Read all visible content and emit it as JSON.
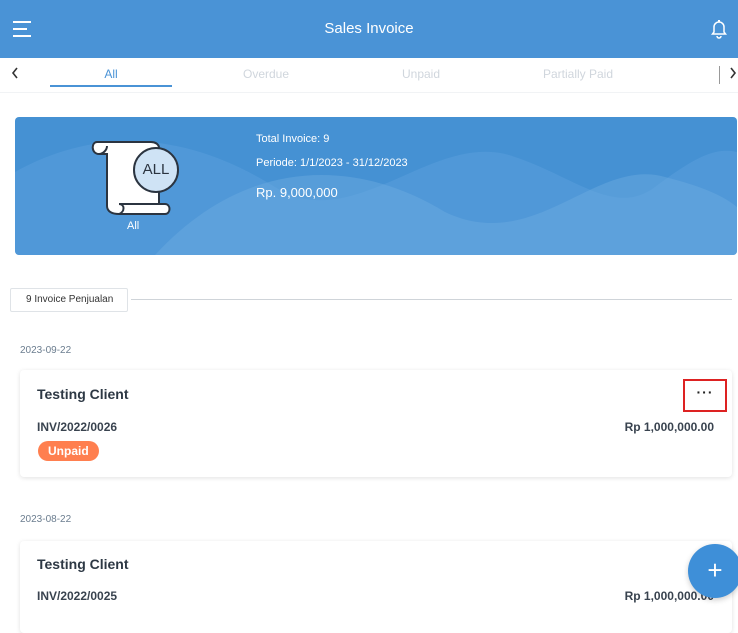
{
  "header": {
    "title": "Sales Invoice",
    "menu_icon": "hamburger-menu-icon",
    "bell_icon": "bell-icon"
  },
  "tabs": {
    "items": [
      {
        "label": "All",
        "active": true
      },
      {
        "label": "Overdue",
        "active": false
      },
      {
        "label": "Unpaid",
        "active": false
      },
      {
        "label": "Partially Paid",
        "active": false
      }
    ]
  },
  "summary": {
    "total_invoice": "Total Invoice: 9",
    "period": "Periode: 1/1/2023 - 31/12/2023",
    "amount": "Rp. 9,000,000",
    "icon_label": "ALL",
    "icon_caption": "All"
  },
  "list": {
    "section_label": "9 Invoice Penjualan",
    "groups": [
      {
        "date": "2023-09-22",
        "client": "Testing Client",
        "invoice_no": "INV/2022/0026",
        "amount": "Rp 1,000,000.00",
        "status": "Unpaid",
        "menu": "···"
      },
      {
        "date": "2023-08-22",
        "client": "Testing Client",
        "invoice_no": "INV/2022/0025",
        "amount": "Rp 1,000,000.00"
      }
    ]
  },
  "fab": {
    "label": "+"
  },
  "colors": {
    "primary": "#4a93d6",
    "unpaid_badge": "#ff7f4f",
    "highlight_border": "#dd2222"
  }
}
